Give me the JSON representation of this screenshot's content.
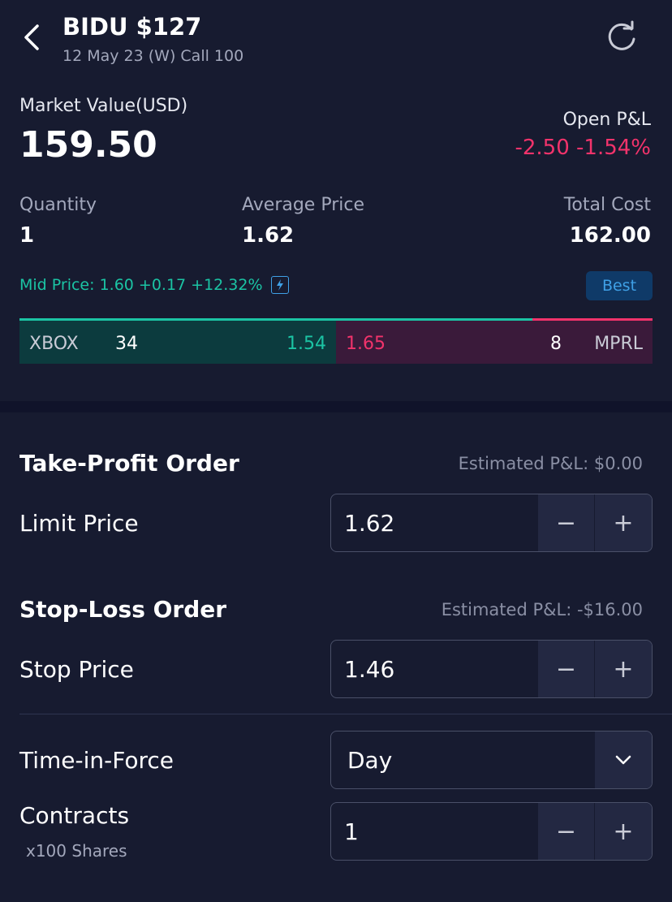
{
  "header": {
    "title": "BIDU $127",
    "subtitle": "12 May 23 (W) Call 100"
  },
  "summary": {
    "market_value_label": "Market Value(USD)",
    "market_value": "159.50",
    "open_pnl_label": "Open P&L",
    "open_pnl_value": "-2.50 -1.54%",
    "quantity_label": "Quantity",
    "quantity": "1",
    "avg_price_label": "Average Price",
    "avg_price": "1.62",
    "total_cost_label": "Total Cost",
    "total_cost": "162.00",
    "mid_price": "Mid Price: 1.60 +0.17 +12.32%",
    "best_label": "Best"
  },
  "quote_bar": {
    "bid_exchange": "XBOX",
    "bid_size": "34",
    "bid_price": "1.54",
    "ask_price": "1.65",
    "ask_size": "8",
    "ask_exchange": "MPRL"
  },
  "take_profit": {
    "title": "Take-Profit Order",
    "estimated": "Estimated P&L: $0.00",
    "field_label": "Limit Price",
    "value": "1.62"
  },
  "stop_loss": {
    "title": "Stop-Loss Order",
    "estimated": "Estimated P&L: -$16.00",
    "field_label": "Stop Price",
    "value": "1.46"
  },
  "time_in_force": {
    "label": "Time-in-Force",
    "value": "Day"
  },
  "contracts": {
    "label": "Contracts",
    "sub_label": "x100 Shares",
    "value": "1"
  },
  "stepper": {
    "minus": "−",
    "plus": "+"
  },
  "colors": {
    "background": "#171b30",
    "positive": "#1bc4a4",
    "negative": "#f2336b",
    "accent": "#3fa0e6"
  }
}
